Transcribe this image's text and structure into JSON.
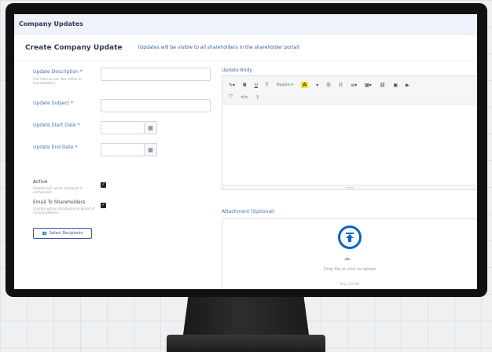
{
  "topbar": {
    "title": "Company Updates"
  },
  "form": {
    "heading": "Create Company Update",
    "note": "(Updates will be visible to all shareholders in the shareholder portal)",
    "description_label": "Update Description *",
    "description_sub": "(For internal use. Not visible to shareholders.)",
    "subject_label": "Update Subject *",
    "start_label": "Update Start Date *",
    "end_label": "Update End Date *",
    "active_label": "Active",
    "active_sub": "(Update will not be displayed if unchecked)",
    "email_label": "Email To Shareholders",
    "email_sub": "(Update will be distributed on behalf of CompanyName)",
    "recipients_button": "Select Recipients",
    "body_label": "Update Body",
    "font_name": "Poppins",
    "attachment_label": "Attachment (Optional)",
    "upload_text": "Drop file or click to upload",
    "upload_limit": "Max 10 MB"
  },
  "toolbar": {
    "bold": "B",
    "underline": "U",
    "clear": "T",
    "font_color": "A",
    "code": "</>",
    "help": "?",
    "fullscreen": "⤧",
    "resize": "≡≡≡"
  },
  "colors": {
    "accent": "#3c5aa0",
    "upload_icon": "#0d63c9",
    "highlight": "#ffe600"
  }
}
